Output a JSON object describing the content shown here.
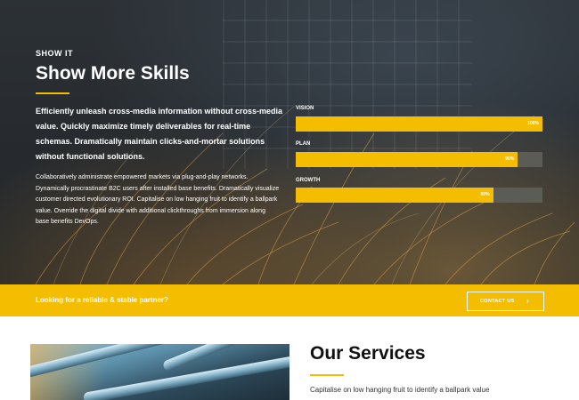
{
  "hero": {
    "eyebrow": "SHOW IT",
    "title": "Show More Skills",
    "lead": "Efficiently unleash cross-media information without cross-media value. Quickly maximize timely deliverables for real-time schemas. Dramatically maintain clicks-and-mortar solutions without functional solutions.",
    "body": "Collaboratively administrate empowered markets via plug-and-play networks. Dynamically procrastinate B2C users after installed base benefits. Dramatically visualize customer directed evolutionary ROI. Capitalise on low hanging fruit to identify a ballpark value. Override the digital divide with additional clickthroughs from immersion along base benefits DevOps."
  },
  "skills": [
    {
      "label": "VISION",
      "percent": 100,
      "percent_text": "100%"
    },
    {
      "label": "PLAN",
      "percent": 90,
      "percent_text": "90%"
    },
    {
      "label": "GROWTH",
      "percent": 80,
      "percent_text": "80%"
    }
  ],
  "cta": {
    "text": "Looking for a reliable & stable partner?",
    "button_label": "CONTACT US",
    "button_icon": "chevron-right-icon"
  },
  "services": {
    "title": "Our Services",
    "text": "Capitalise on low hanging fruit to identify a ballpark value"
  },
  "colors": {
    "accent": "#f5bd00",
    "hero_dark": "#2a2e32",
    "bar_track": "#5c5c56"
  }
}
